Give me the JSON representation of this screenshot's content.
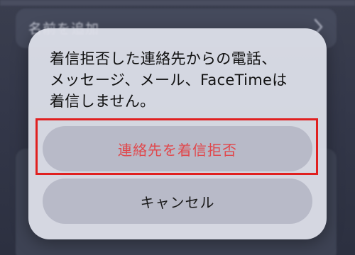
{
  "background": {
    "row_label": "名前を追加"
  },
  "alert": {
    "message": "着信拒否した連絡先からの電話、\nメッセージ、メール、FaceTimeは\n着信しません。",
    "block_button_label": "連絡先を着信拒否",
    "cancel_button_label": "キャンセル"
  },
  "colors": {
    "destructive": "#e0484c",
    "highlight": "#e02020"
  }
}
